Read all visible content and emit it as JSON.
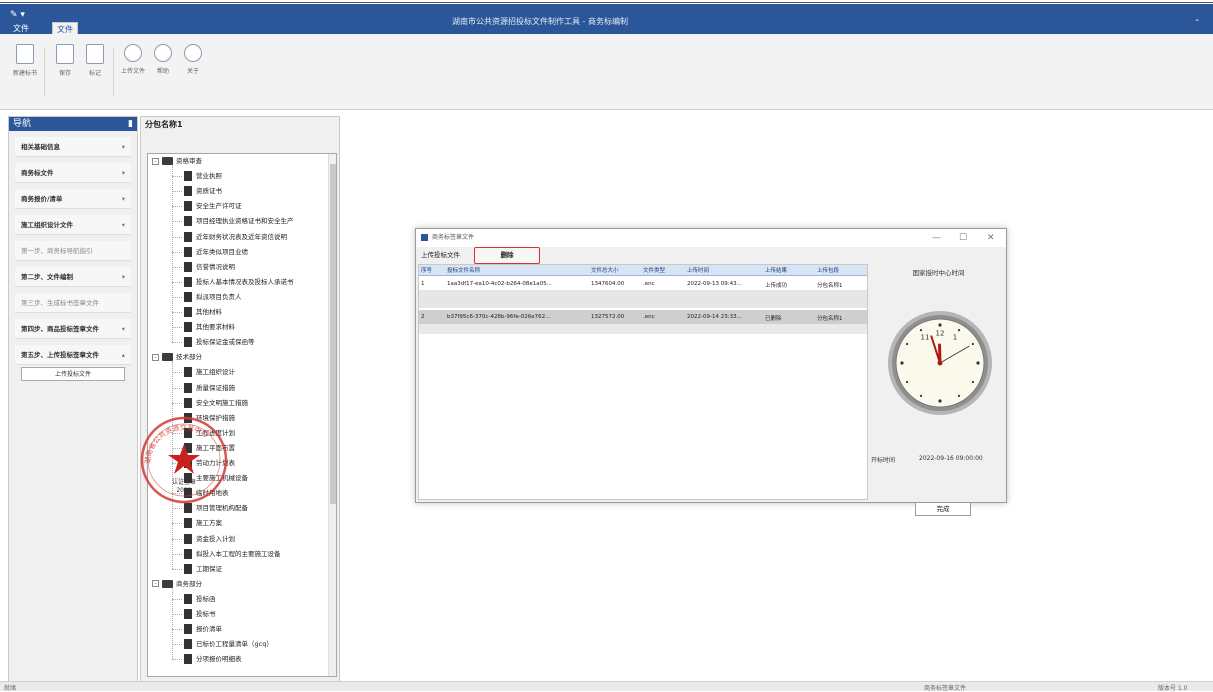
{
  "window": {
    "title": "湖南市公共资源招投标文件制作工具 - 商务标编制",
    "quick_access": "✎ ▾",
    "tabs": [
      "文件",
      "文件"
    ],
    "minimize": "-"
  },
  "ribbon": {
    "buttons": [
      {
        "label": "新建标书",
        "icon": "new-document-icon"
      },
      {
        "label": "保存",
        "icon": "save-icon"
      },
      {
        "label": "标记",
        "icon": "mark-icon"
      },
      {
        "label": "上传文件",
        "icon": "upload-icon"
      },
      {
        "label": "帮助",
        "icon": "help-icon"
      },
      {
        "label": "关于",
        "icon": "info-icon"
      }
    ]
  },
  "nav": {
    "header": "导航",
    "pin": "▮",
    "items": [
      {
        "label": "相关基础信息",
        "chev": "▾"
      },
      {
        "label": "商务标文件",
        "chev": "▾"
      },
      {
        "label": "商务报价/清单",
        "chev": "▾"
      },
      {
        "label": "施工组织设计文件",
        "chev": "▾"
      },
      {
        "label": "第一步、商务标导航指引",
        "chev": ""
      },
      {
        "label": "第二步、文件编制",
        "chev": "▾"
      },
      {
        "label": "第三步、生成标书签章文件",
        "chev": ""
      },
      {
        "label": "第四步、商品投标签章文件",
        "chev": "▾"
      },
      {
        "label": "第五步、上传投标签章文件",
        "chev": "▴"
      }
    ],
    "sub_button": "上传投标文件"
  },
  "tree": {
    "header": "分包名称1",
    "group1": {
      "label": "资格审查",
      "items": [
        "营业执照",
        "资质证书",
        "安全生产许可证",
        "项目经理执业资格证书和安全生产",
        "近年财务状况表及近年资信说明",
        "近年类似项目业绩",
        "信誉情况说明",
        "投标人基本情况表及投标人承诺书",
        "拟派项目负责人",
        "其他材料",
        "其他要求材料",
        "投标保证金或保函等"
      ]
    },
    "group2": {
      "label": "技术部分",
      "items": [
        "施工组织设计",
        "质量保证措施",
        "安全文明施工措施",
        "环境保护措施",
        "工程进度计划",
        "施工平面布置",
        "劳动力计划表",
        "主要施工机械设备",
        "临时用地表",
        "项目管理机构配备",
        "施工方案",
        "资金投入计划",
        "拟投入本工程的主要施工设备",
        "工期保证"
      ]
    },
    "group3": {
      "label": "商务部分",
      "items": [
        "投标函",
        "投标书",
        "报价清单",
        "已标价工程量清单（gcq）",
        "分项报价明细表"
      ]
    },
    "expander_open": "-"
  },
  "seal": {
    "ring_text": "湖南省公共资源交易中心",
    "line1": "认证签章",
    "line2": "2022"
  },
  "dialog": {
    "title": "商务标签章文件",
    "controls": [
      "—",
      "☐",
      "✕"
    ],
    "upload_label": "上传投标文件",
    "delete_label": "删除",
    "columns": [
      "序号",
      "投标文件名称",
      "文件总大小",
      "文件类型",
      "上传时间",
      "上传结果",
      "上传包段"
    ],
    "rows": [
      {
        "no": "1",
        "name": "1aa3df17-ea10-4c02-b264-08e1a05...",
        "size": "1347604.00",
        "type": ".enc",
        "time": "2022-09-13 09:43...",
        "result": "上传成功",
        "pkg": "分包名称1"
      },
      {
        "no": "2",
        "name": "b37f95c6-370c-428b-96fe-026e762...",
        "size": "1327572.00",
        "type": ".enc",
        "time": "2022-09-14 23:33...",
        "result": "已删除",
        "pkg": "分包名称1"
      }
    ],
    "clock_title": "国家授时中心时间",
    "clock_time": {
      "hours": 11,
      "minutes": 57,
      "seconds": 10
    },
    "time_label": "开标时间",
    "time_value": "2022-09-16 09:00:00",
    "finish_label": "完成"
  },
  "statusbar": {
    "left": "就绪",
    "mid": "商务标签章文件",
    "right": "版本号 1.0"
  }
}
